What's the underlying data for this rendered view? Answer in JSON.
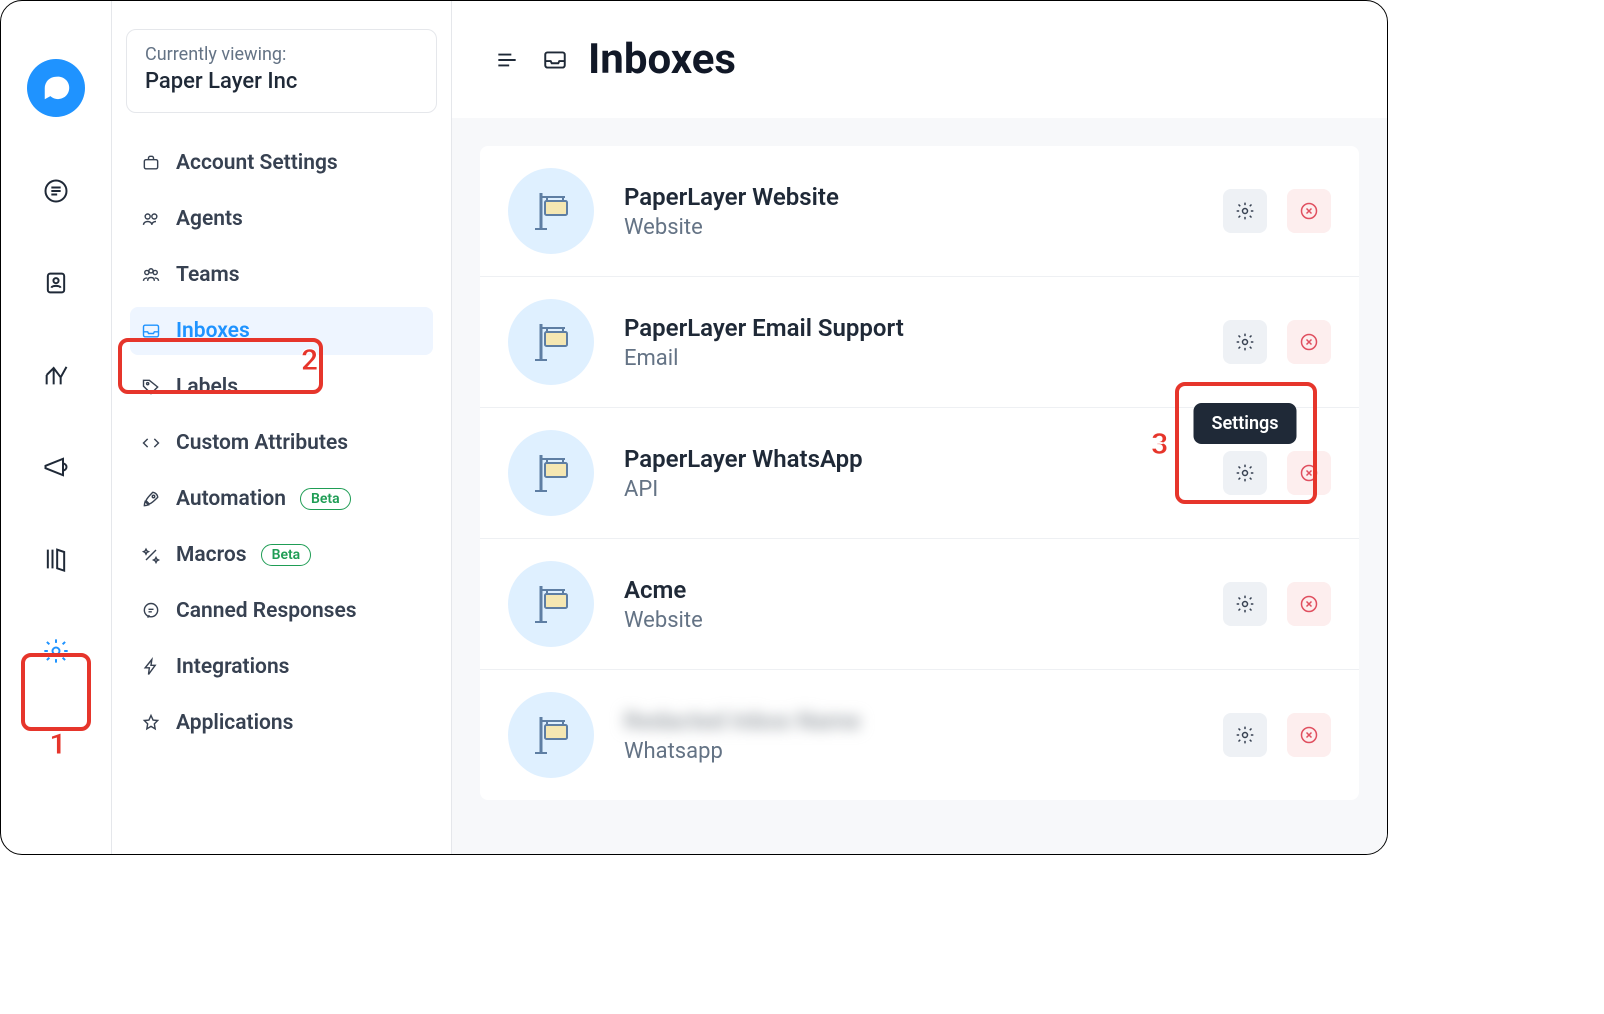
{
  "account": {
    "viewing_label": "Currently viewing:",
    "name": "Paper Layer Inc"
  },
  "sidebar_nav": [
    {
      "label": "Account Settings",
      "icon": "briefcase"
    },
    {
      "label": "Agents",
      "icon": "people"
    },
    {
      "label": "Teams",
      "icon": "people-group"
    },
    {
      "label": "Inboxes",
      "icon": "inbox",
      "active": true
    },
    {
      "label": "Labels",
      "icon": "tag"
    },
    {
      "label": "Custom Attributes",
      "icon": "code"
    },
    {
      "label": "Automation",
      "icon": "rocket",
      "badge": "Beta"
    },
    {
      "label": "Macros",
      "icon": "wand",
      "badge": "Beta"
    },
    {
      "label": "Canned Responses",
      "icon": "chat"
    },
    {
      "label": "Integrations",
      "icon": "bolt"
    },
    {
      "label": "Applications",
      "icon": "star"
    }
  ],
  "header": {
    "title": "Inboxes"
  },
  "inboxes": [
    {
      "name": "PaperLayer Website",
      "channel": "Website"
    },
    {
      "name": "PaperLayer Email Support",
      "channel": "Email"
    },
    {
      "name": "PaperLayer WhatsApp",
      "channel": "API",
      "tooltip": "Settings"
    },
    {
      "name": "Acme",
      "channel": "Website"
    },
    {
      "name": "Redacted Inbox Name",
      "channel": "Whatsapp",
      "blurred": true
    }
  ],
  "tooltip_text": "Settings",
  "annotations": {
    "1": "1",
    "2": "2",
    "3": "3"
  }
}
